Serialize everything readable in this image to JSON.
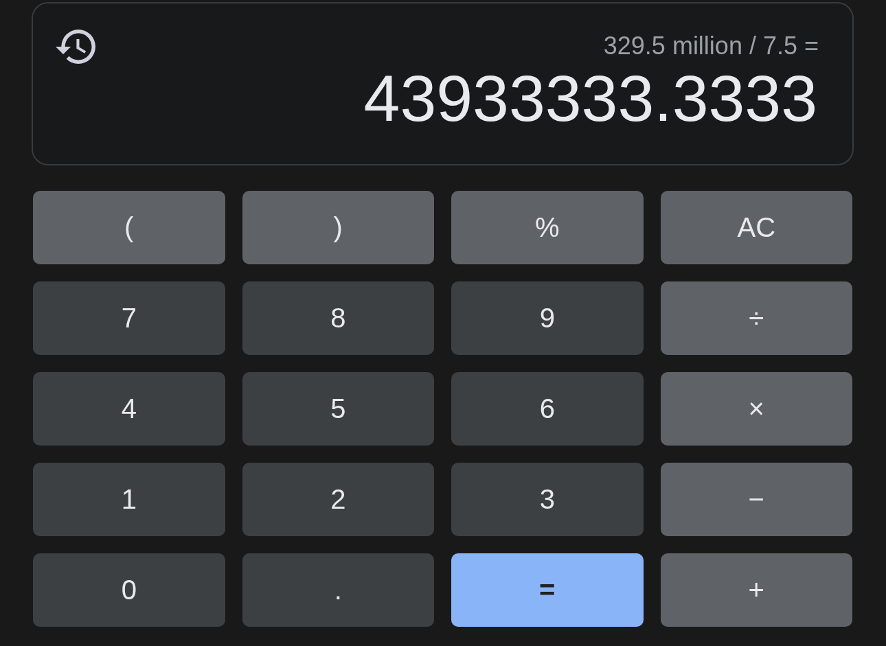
{
  "display": {
    "expression": "329.5 million / 7.5 =",
    "result": "43933333.3333"
  },
  "keys": [
    {
      "label": "(",
      "kind": "function"
    },
    {
      "label": ")",
      "kind": "function"
    },
    {
      "label": "%",
      "kind": "function"
    },
    {
      "label": "AC",
      "kind": "function"
    },
    {
      "label": "7",
      "kind": "digit"
    },
    {
      "label": "8",
      "kind": "digit"
    },
    {
      "label": "9",
      "kind": "digit"
    },
    {
      "label": "÷",
      "kind": "operator"
    },
    {
      "label": "4",
      "kind": "digit"
    },
    {
      "label": "5",
      "kind": "digit"
    },
    {
      "label": "6",
      "kind": "digit"
    },
    {
      "label": "×",
      "kind": "operator"
    },
    {
      "label": "1",
      "kind": "digit"
    },
    {
      "label": "2",
      "kind": "digit"
    },
    {
      "label": "3",
      "kind": "digit"
    },
    {
      "label": "−",
      "kind": "operator"
    },
    {
      "label": "0",
      "kind": "digit"
    },
    {
      "label": ".",
      "kind": "digit"
    },
    {
      "label": "=",
      "kind": "equals"
    },
    {
      "label": "+",
      "kind": "operator"
    }
  ]
}
